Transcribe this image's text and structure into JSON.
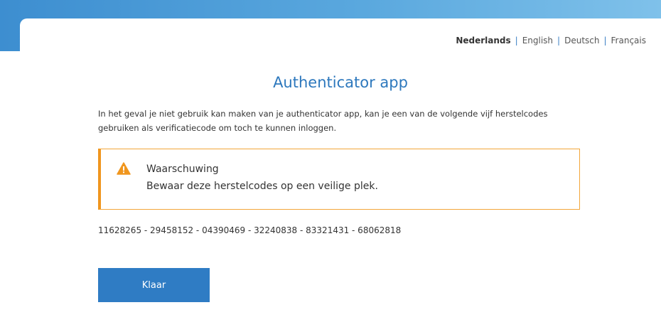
{
  "languages": [
    {
      "label": "Nederlands",
      "active": true
    },
    {
      "label": "English",
      "active": false
    },
    {
      "label": "Deutsch",
      "active": false
    },
    {
      "label": "Français",
      "active": false
    }
  ],
  "language_separator": "|",
  "page_title": "Authenticator app",
  "intro_text": "In het geval je niet gebruik kan maken van je authenticator app, kan je een van de volgende vijf herstelcodes gebruiken als verificatiecode om toch te kunnen inloggen.",
  "warning": {
    "title": "Waarschuwing",
    "text": "Bewaar deze herstelcodes op een veilige plek.",
    "icon": "warning-triangle-icon",
    "color": "#f0961e"
  },
  "recovery_codes": "11628265 - 29458152 - 04390469 - 32240838 - 83321431 - 68062818",
  "done_button_label": "Klaar",
  "colors": {
    "accent": "#2f7cc4",
    "warning": "#f0961e",
    "header_gradient_start": "#3d8ed0",
    "header_gradient_end": "#7fc1ea"
  }
}
